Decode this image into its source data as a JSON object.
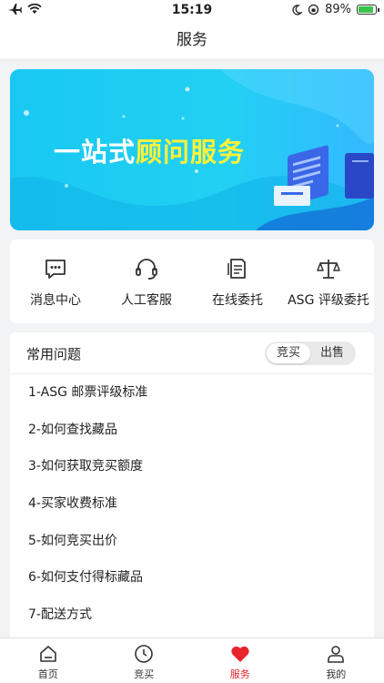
{
  "status_bar": {
    "time": "15:19",
    "battery": "89%",
    "battery_level": 0.89
  },
  "nav": {
    "title": "服务"
  },
  "banner": {
    "title_plain": "一站式",
    "title_highlight": "顾问服务"
  },
  "services": [
    {
      "label": "消息中心",
      "icon": "message-icon"
    },
    {
      "label": "人工客服",
      "icon": "headset-icon"
    },
    {
      "label": "在线委托",
      "icon": "document-icon"
    },
    {
      "label": "ASG 评级委托",
      "icon": "scale-icon"
    }
  ],
  "faq": {
    "title": "常用问题",
    "segments": [
      "竞买",
      "出售"
    ],
    "active_segment": "竞买",
    "items": [
      "1-ASG 邮票评级标准",
      "2-如何查找藏品",
      "3-如何获取竞买额度",
      "4-买家收费标准",
      "5-如何竞买出价",
      "6-如何支付得标藏品",
      "7-配送方式"
    ]
  },
  "tabbar": [
    {
      "label": "首页",
      "icon": "home-icon"
    },
    {
      "label": "竞买",
      "icon": "clock-icon"
    },
    {
      "label": "服务",
      "icon": "heart-icon",
      "active": true
    },
    {
      "label": "我的",
      "icon": "user-icon"
    }
  ],
  "colors": {
    "accent": "#e8232c",
    "banner_from": "#19c8f2",
    "banner_to": "#34b8ff",
    "highlight": "#fbf23a"
  }
}
